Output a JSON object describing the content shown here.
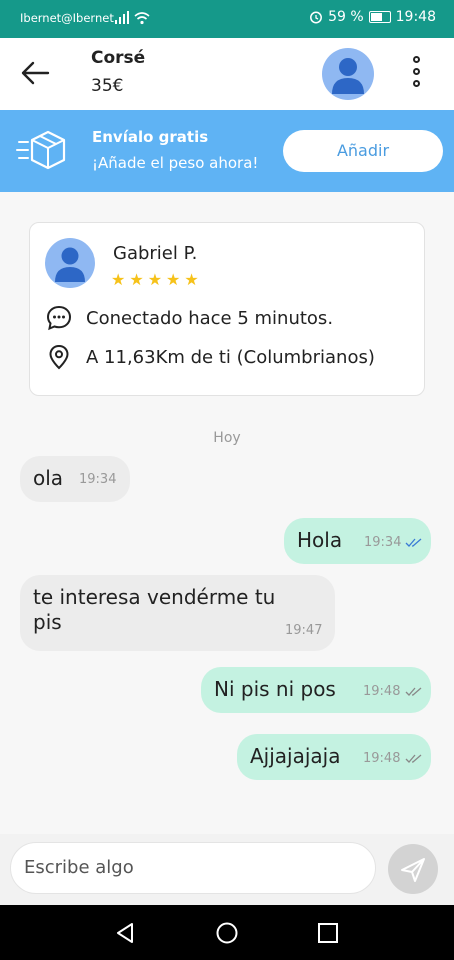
{
  "status_bar": {
    "carrier": "Ibernet@Ibernet",
    "battery": "59 %",
    "time": "19:48"
  },
  "header": {
    "title": "Corsé",
    "price": "35€"
  },
  "banner": {
    "title": "Envíalo gratis",
    "subtitle": "¡Añade el peso ahora!",
    "button": "Añadir"
  },
  "seller": {
    "name": "Gabriel P.",
    "rating": 5,
    "stars": [
      "★",
      "★",
      "★",
      "★",
      "★"
    ],
    "online_status": "Conectado hace 5 minutos.",
    "location": "A 11,63Km de ti (Columbrianos)"
  },
  "chat": {
    "day_label": "Hoy",
    "messages": [
      {
        "text": "ola",
        "time": "19:34",
        "direction": "incoming"
      },
      {
        "text": "Hola",
        "time": "19:34",
        "direction": "outgoing",
        "read": true
      },
      {
        "text": "te interesa vendérme tu pis",
        "time": "19:47",
        "direction": "incoming"
      },
      {
        "text": "Ni pis ni pos",
        "time": "19:48",
        "direction": "outgoing",
        "read": false
      },
      {
        "text": "Ajjajajaja",
        "time": "19:48",
        "direction": "outgoing",
        "read": false
      }
    ]
  },
  "composer": {
    "placeholder": "Escribe algo"
  },
  "colors": {
    "status_bar": "#15998a",
    "banner": "#5fb3f4",
    "outgoing_bubble": "#c4f2e1",
    "incoming_bubble": "#ececec",
    "stars": "#f6c21a"
  }
}
